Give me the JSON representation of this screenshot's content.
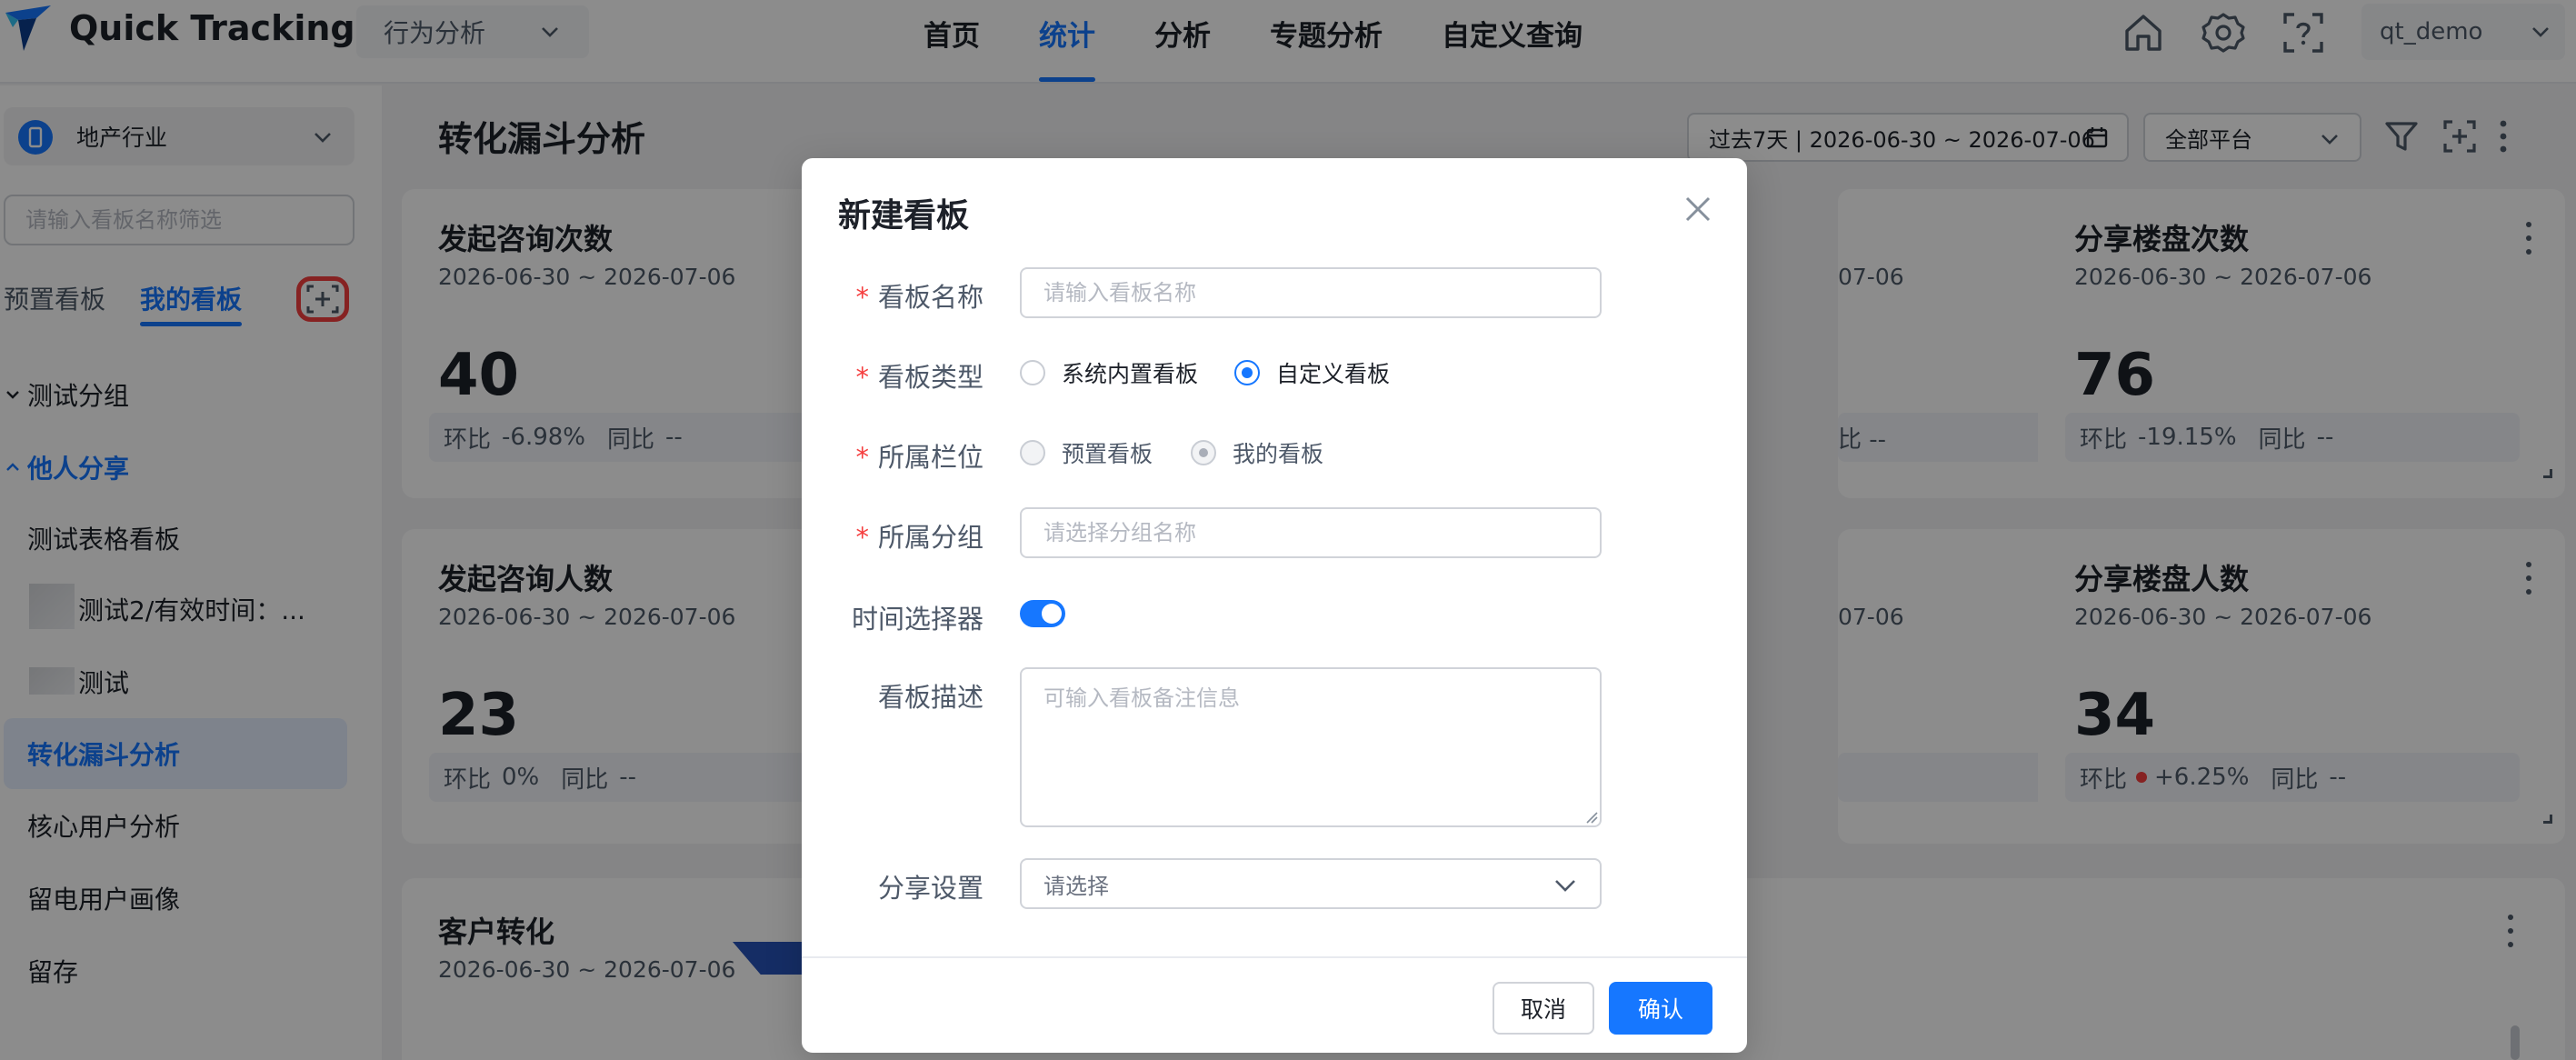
{
  "app": {
    "title": "Quick Tracking",
    "module": "行为分析",
    "user": "qt_demo"
  },
  "nav": {
    "items": [
      "首页",
      "统计",
      "分析",
      "专题分析",
      "自定义查询"
    ],
    "active": "统计"
  },
  "sidebar": {
    "industry": "地产行业",
    "filter_placeholder": "请输入看板名称筛选",
    "tabs": [
      "预置看板",
      "我的看板"
    ],
    "active_tab": "我的看板",
    "groups": [
      {
        "label": "测试分组",
        "expanded": false
      },
      {
        "label": "他人分享",
        "expanded": true
      }
    ],
    "items": [
      "测试表格看板",
      "测试2/有效时间：...",
      "测试",
      "转化漏斗分析",
      "核心用户分析",
      "留电用户画像",
      "留存"
    ],
    "active_item": "转化漏斗分析"
  },
  "main": {
    "title": "转化漏斗分析",
    "date_range": "过去7天 | 2026-06-30 ~ 2026-07-06",
    "platform": "全部平台",
    "cards": [
      {
        "title": "发起咨询次数",
        "date": "2026-06-30 ~ 2026-07-06",
        "value": "40",
        "mom_label": "环比",
        "mom": "-6.98%",
        "yoy_label": "同比",
        "yoy": "--"
      },
      {
        "date_tail": "07-06",
        "yoy_tail": "比 --"
      },
      {
        "title": "分享楼盘次数",
        "date": "2026-06-30 ~ 2026-07-06",
        "value": "76",
        "mom_label": "环比",
        "mom": "-19.15%",
        "yoy_label": "同比",
        "yoy": "--"
      },
      {
        "title": "发起咨询人数",
        "date": "2026-06-30 ~ 2026-07-06",
        "value": "23",
        "mom_label": "环比",
        "mom": "0%",
        "yoy_label": "同比",
        "yoy": "--"
      },
      {
        "date_tail": "07-06"
      },
      {
        "title": "分享楼盘人数",
        "date": "2026-06-30 ~ 2026-07-06",
        "value": "34",
        "mom_label": "环比",
        "mom": "+6.25%",
        "yoy_label": "同比",
        "yoy": "--"
      },
      {
        "title": "客户转化",
        "date": "2026-06-30 ~ 2026-07-06"
      }
    ]
  },
  "modal": {
    "title": "新建看板",
    "name_label": "看板名称",
    "name_placeholder": "请输入看板名称",
    "type_label": "看板类型",
    "type_options": [
      "系统内置看板",
      "自定义看板"
    ],
    "type_selected": "自定义看板",
    "column_label": "所属栏位",
    "column_options": [
      "预置看板",
      "我的看板"
    ],
    "column_selected": "我的看板",
    "group_label": "所属分组",
    "group_placeholder": "请选择分组名称",
    "time_picker_label": "时间选择器",
    "time_picker_enabled": true,
    "desc_label": "看板描述",
    "desc_placeholder": "可输入看板备注信息",
    "share_label": "分享设置",
    "share_placeholder": "请选择",
    "cancel_label": "取消",
    "ok_label": "确认"
  },
  "colors": {
    "accent": "#1677ff",
    "danger": "#f53f3f",
    "funnel": "#2753b8"
  }
}
